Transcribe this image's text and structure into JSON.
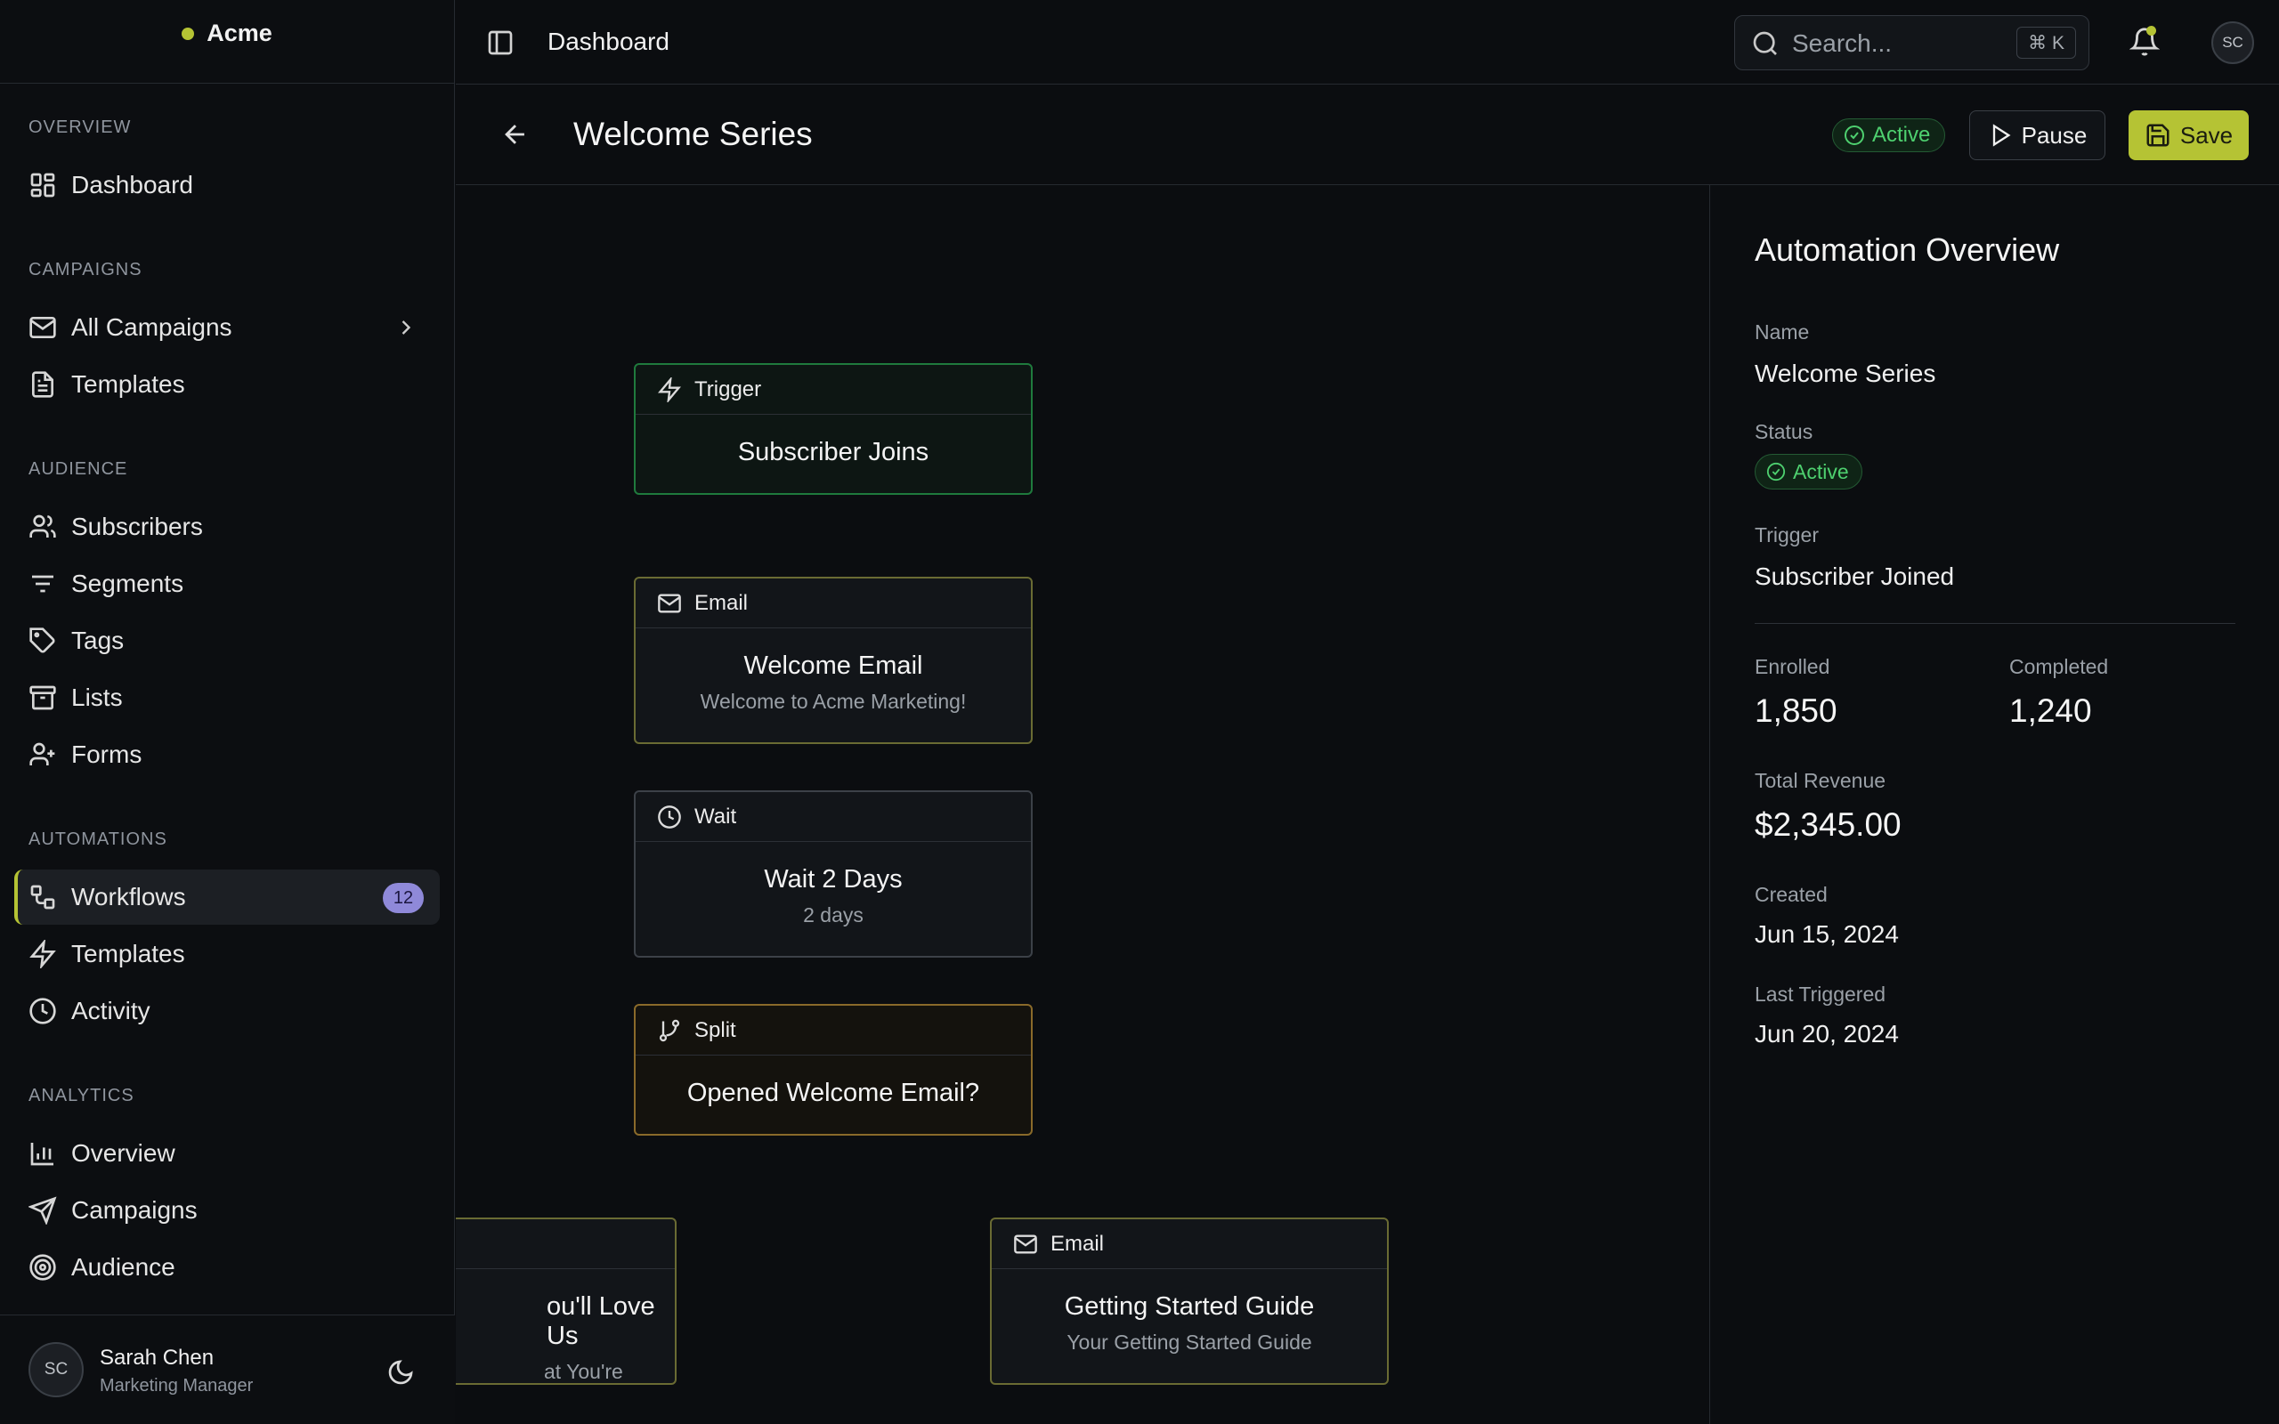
{
  "brand": {
    "name": "Acme"
  },
  "sidebar": {
    "sections": [
      {
        "title": "OVERVIEW"
      },
      {
        "title": "CAMPAIGNS"
      },
      {
        "title": "AUDIENCE"
      },
      {
        "title": "AUTOMATIONS"
      },
      {
        "title": "ANALYTICS"
      }
    ],
    "items": [
      {
        "label": "Dashboard",
        "icon": "dashboard-icon"
      },
      {
        "label": "All Campaigns",
        "icon": "mail-icon"
      },
      {
        "label": "Templates",
        "icon": "document-icon"
      },
      {
        "label": "Subscribers",
        "icon": "users-icon"
      },
      {
        "label": "Segments",
        "icon": "filter-icon"
      },
      {
        "label": "Tags",
        "icon": "tag-icon"
      },
      {
        "label": "Lists",
        "icon": "archive-icon"
      },
      {
        "label": "Forms",
        "icon": "user-plus-icon"
      },
      {
        "label": "Workflows",
        "icon": "workflow-icon",
        "badge": "12",
        "active": true
      },
      {
        "label": "Templates",
        "icon": "zap-icon"
      },
      {
        "label": "Activity",
        "icon": "clock-icon"
      },
      {
        "label": "Overview",
        "icon": "bar-chart-icon"
      },
      {
        "label": "Campaigns",
        "icon": "send-icon"
      },
      {
        "label": "Audience",
        "icon": "target-icon"
      }
    ]
  },
  "user": {
    "initials": "SC",
    "name": "Sarah Chen",
    "role": "Marketing Manager"
  },
  "topbar": {
    "title": "Dashboard",
    "search_placeholder": "Search...",
    "shortcut": "⌘ K",
    "avatar_initials": "SC"
  },
  "header": {
    "title": "Welcome Series",
    "status": "Active",
    "pause_label": "Pause",
    "save_label": "Save"
  },
  "workflow": {
    "nodes": [
      {
        "type": "Trigger",
        "title": "Subscriber Joins",
        "subtitle": ""
      },
      {
        "type": "Email",
        "title": "Welcome Email",
        "subtitle": "Welcome to Acme Marketing!"
      },
      {
        "type": "Wait",
        "title": "Wait 2 Days",
        "subtitle": "2 days"
      },
      {
        "type": "Split",
        "title": "Opened Welcome Email?",
        "subtitle": ""
      },
      {
        "type": "Email",
        "title": "ou'll Love Us",
        "subtitle": "at You're Missing"
      },
      {
        "type": "Email",
        "title": "Getting Started Guide",
        "subtitle": "Your Getting Started Guide"
      }
    ]
  },
  "overview": {
    "title": "Automation Overview",
    "name_label": "Name",
    "name": "Welcome Series",
    "status_label": "Status",
    "status": "Active",
    "trigger_label": "Trigger",
    "trigger": "Subscriber Joined",
    "enrolled_label": "Enrolled",
    "enrolled": "1,850",
    "completed_label": "Completed",
    "completed": "1,240",
    "revenue_label": "Total Revenue",
    "revenue": "$2,345.00",
    "created_label": "Created",
    "created": "Jun 15, 2024",
    "last_triggered_label": "Last Triggered",
    "last_triggered": "Jun 20, 2024"
  },
  "colors": {
    "accent": "#b5c334",
    "success": "#4ed06f",
    "badge": "#8f89d9",
    "background": "#0b0d10"
  }
}
